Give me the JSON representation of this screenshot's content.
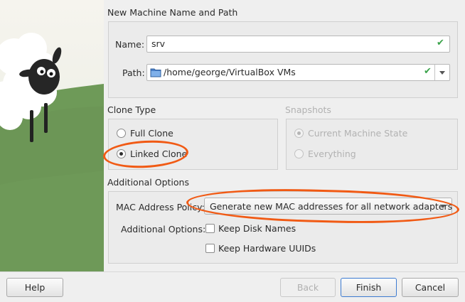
{
  "window": {
    "section_name_path": "New Machine Name and Path",
    "name_label": "Name:",
    "name_value": "srv",
    "path_label": "Path:",
    "path_value": "/home/george/VirtualBox VMs"
  },
  "clone_type": {
    "title": "Clone Type",
    "options": [
      {
        "label": "Full Clone",
        "selected": false
      },
      {
        "label": "Linked Clone",
        "selected": true
      }
    ]
  },
  "snapshots": {
    "title": "Snapshots",
    "options": [
      {
        "label": "Current Machine State",
        "selected": true
      },
      {
        "label": "Everything",
        "selected": false
      }
    ],
    "enabled": false
  },
  "additional": {
    "title": "Additional Options",
    "mac_label": "MAC Address Policy:",
    "mac_value": "Generate new MAC addresses for all network adapters",
    "options_label": "Additional Options:",
    "keep_disk_names": "Keep Disk Names",
    "keep_hw_uuids": "Keep Hardware UUIDs"
  },
  "buttons": {
    "help": "Help",
    "back": "Back",
    "finish": "Finish",
    "cancel": "Cancel"
  },
  "colors": {
    "accent": "#3d7bd1",
    "annotation": "#f15a14",
    "valid_check": "#3aa34a",
    "grass": "#6e9a58"
  },
  "icons": {
    "name_valid": "check-icon",
    "path_valid": "check-icon",
    "path_folder": "folder-icon",
    "dropdown": "chevron-down-icon"
  }
}
